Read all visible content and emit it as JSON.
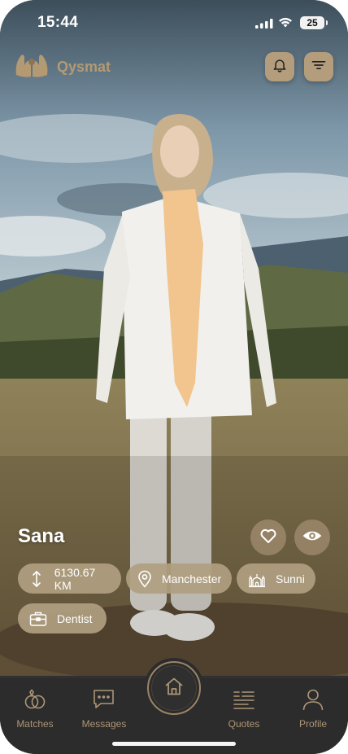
{
  "status_bar": {
    "time": "15:44",
    "battery": "25"
  },
  "header": {
    "app_name": "Qysmat",
    "logo_icon": "praying-hands-icon",
    "notifications_icon": "bell-icon",
    "filter_icon": "filter-icon"
  },
  "profile": {
    "name": "Sana",
    "like_icon": "heart-icon",
    "view_icon": "eye-icon",
    "chips": {
      "distance": {
        "label": "6130.67 KM",
        "icon": "distance-arrows-icon"
      },
      "city": {
        "label": "Manchester",
        "icon": "location-pin-icon"
      },
      "sect": {
        "label": "Sunni",
        "icon": "mosque-icon"
      },
      "profession": {
        "label": "Dentist",
        "icon": "briefcase-icon"
      }
    }
  },
  "nav": {
    "items": [
      {
        "label": "Matches",
        "icon": "rings-icon"
      },
      {
        "label": "Messages",
        "icon": "chat-icon"
      },
      {
        "label": "Quotes",
        "icon": "quotes-icon"
      },
      {
        "label": "Profile",
        "icon": "person-icon"
      }
    ],
    "home_icon": "home-icon"
  },
  "colors": {
    "accent": "#b39a72",
    "chip_background": "#b09e80",
    "nav_background": "#2c2c2c",
    "nav_text": "#ad9676"
  }
}
